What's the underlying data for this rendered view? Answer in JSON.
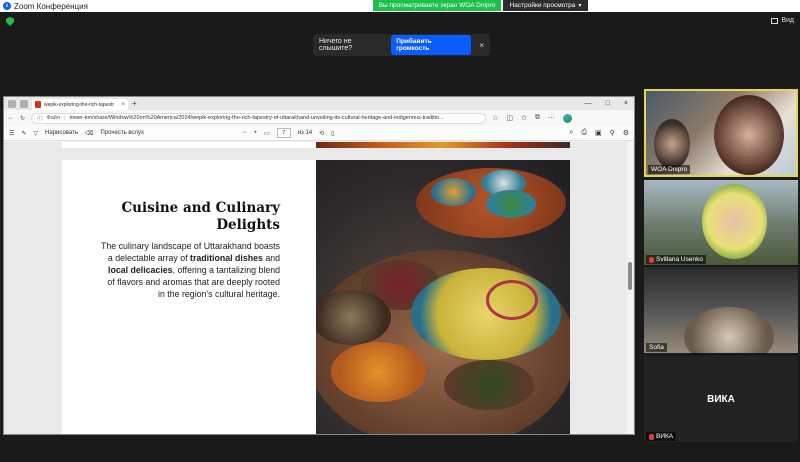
{
  "zoom": {
    "window_title": "Zoom Конференция",
    "share_banner": "Вы просматриваете экран WOA Dnipro",
    "view_options": "Настройки просмотра",
    "view_button": "Вид",
    "audio_prompt": {
      "text": "Ничего не слышите?",
      "button": "Прибавить громкость",
      "close": "×"
    }
  },
  "browser": {
    "tab_title": "wepik-exploring-the-rich-tapestr",
    "tab_close": "×",
    "new_tab": "+",
    "window_controls": [
      "—",
      "□",
      "×"
    ],
    "address_label": "Файл",
    "url": "tower-km/share/Window%20on%20America/2024/wepik-exploring-the-rich-tapestry-of-uttarakhand-unveiling-its-cultural-heritage-and-indigenous-traditio...",
    "toolbar": {
      "draw": "Нарисовать",
      "read_aloud": "Прочесть вслух",
      "zoom_out": "−",
      "zoom_in": "+",
      "page_current": "7",
      "page_total": "из 14"
    }
  },
  "page": {
    "title": "Cuisine and Culinary Delights",
    "body_1": "The culinary landscape of Uttarakhand boasts a delectable array of ",
    "body_bold_1": "traditional dishes",
    "body_2": " and ",
    "body_bold_2": "local delicacies",
    "body_3": ", offering a tantalizing blend of flavors and aromas that are deeply rooted in the region's cultural heritage."
  },
  "participants": [
    {
      "name": "WOA Dnipro",
      "muted": false,
      "active": true
    },
    {
      "name": "Svitlana Usenko",
      "muted": true
    },
    {
      "name": "Sofia",
      "muted": false
    },
    {
      "name": "ВИКА",
      "muted": true,
      "label": "ВИКА"
    }
  ],
  "colors": {
    "zoom_blue": "#0b5cff",
    "share_green": "#1fbf4b",
    "active_speaker": "#e6d84a"
  }
}
